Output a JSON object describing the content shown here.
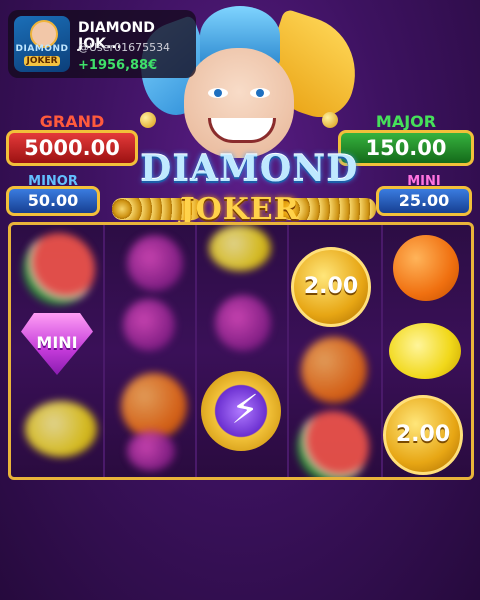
{
  "usercard": {
    "title": "DIAMOND JOK...",
    "handle": "@User01675534",
    "balance": "+1956,88€",
    "avatar_logo_top": "DIAMOND",
    "avatar_logo_bottom": "JOKER"
  },
  "logo": {
    "line1": "DIAMOND",
    "line2": "JOKER"
  },
  "jackpots": {
    "grand": {
      "label": "GRAND",
      "value": "5000.00"
    },
    "major": {
      "label": "MAJOR",
      "value": "150.00"
    },
    "minor": {
      "label": "MINOR",
      "value": "50.00"
    },
    "mini": {
      "label": "MINI",
      "value": "25.00"
    }
  },
  "reels": {
    "coin_top": "2.00",
    "coin_bottom": "2.00",
    "mini_symbol": "MINI",
    "bolt_glyph": "⚡"
  },
  "colors": {
    "grand": "#e43a3a",
    "major": "#36b23e",
    "minor": "#3a7ce0",
    "mini": "#3a7ce0",
    "frame": "#e9b43a",
    "balance": "#3fe06a"
  }
}
